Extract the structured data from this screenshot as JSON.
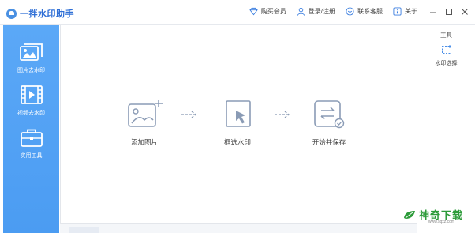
{
  "app": {
    "title": "一拌水印助手"
  },
  "top_actions": [
    {
      "label": "购买会员",
      "icon": "diamond-icon"
    },
    {
      "label": "登录/注册",
      "icon": "user-icon"
    },
    {
      "label": "联系客服",
      "icon": "chat-icon"
    },
    {
      "label": "关于",
      "icon": "info-icon"
    }
  ],
  "window_controls": [
    "minimize",
    "maximize",
    "close"
  ],
  "sidebar": {
    "items": [
      {
        "label": "图片去水印",
        "icon": "image-stack-icon"
      },
      {
        "label": "视频去水印",
        "icon": "video-icon"
      },
      {
        "label": "实用工具",
        "icon": "toolbox-icon"
      }
    ]
  },
  "steps": [
    {
      "label": "添加图片",
      "icon": "add-image-icon"
    },
    {
      "label": "框选水印",
      "icon": "select-cursor-icon"
    },
    {
      "label": "开始并保存",
      "icon": "convert-save-icon"
    }
  ],
  "tools": {
    "title": "工具",
    "items": [
      {
        "label": "水印选择",
        "icon": "dashed-select-icon"
      }
    ]
  },
  "watermark": {
    "text": "神奇下载",
    "url": "www.sqxz.com"
  },
  "colors": {
    "sidebar": "#4b9cf2",
    "accent": "#2f6fd6",
    "icon_gray": "#8a9bb5",
    "watermark_green": "#2d9b3a"
  }
}
